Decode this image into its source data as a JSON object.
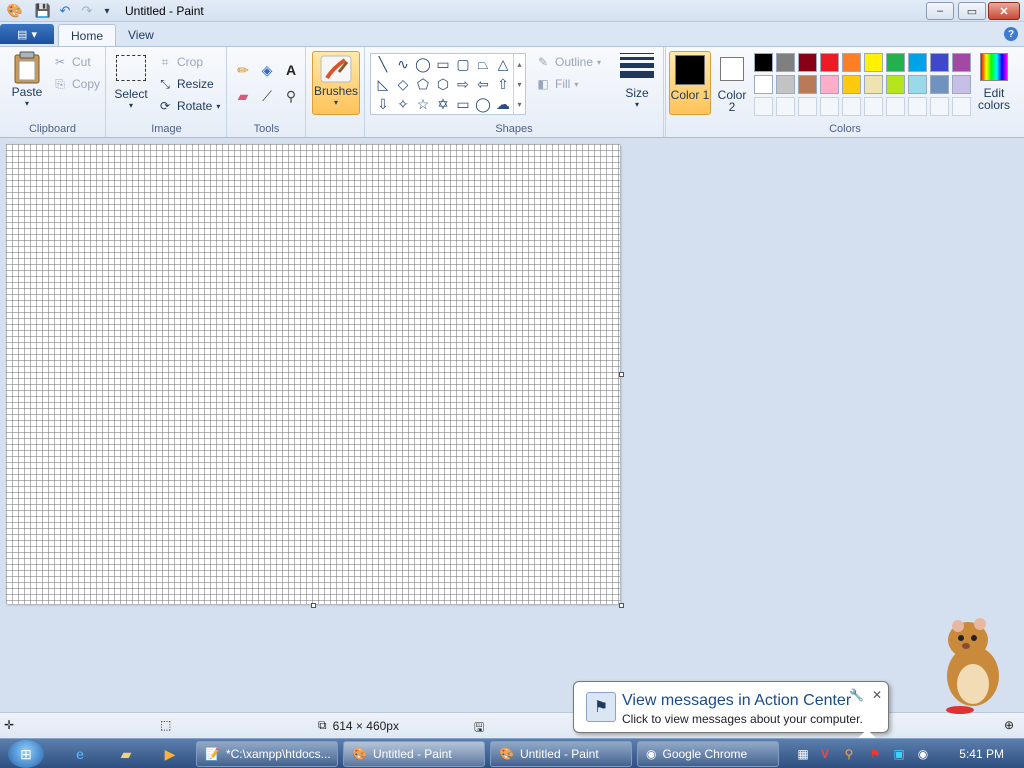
{
  "window": {
    "title": "Untitled - Paint",
    "controls": {
      "minimize": "–",
      "maximize": "▭",
      "close": "✕"
    }
  },
  "tabs": {
    "home": "Home",
    "view": "View"
  },
  "ribbon": {
    "clipboard": {
      "label": "Clipboard",
      "paste": "Paste",
      "cut": "Cut",
      "copy": "Copy"
    },
    "image": {
      "label": "Image",
      "select": "Select",
      "crop": "Crop",
      "resize": "Resize",
      "rotate": "Rotate"
    },
    "tools": {
      "label": "Tools"
    },
    "brushes": {
      "label": "Brushes"
    },
    "shapes": {
      "label": "Shapes",
      "outline": "Outline",
      "fill": "Fill"
    },
    "size": {
      "label": "Size"
    },
    "colors": {
      "label": "Colors",
      "color1": "Color 1",
      "color2": "Color 2",
      "edit": "Edit colors",
      "row1": [
        "#000000",
        "#7f7f7f",
        "#880015",
        "#ed1c24",
        "#ff7f27",
        "#fff200",
        "#22b14c",
        "#00a2e8",
        "#3f48cc",
        "#a349a4"
      ],
      "row2": [
        "#ffffff",
        "#c3c3c3",
        "#b97a57",
        "#ffaec9",
        "#ffc90e",
        "#efe4b0",
        "#b5e61d",
        "#99d9ea",
        "#7092be",
        "#c8bfe7"
      ]
    }
  },
  "status": {
    "dimensions": "614 × 460px"
  },
  "notification": {
    "title": "View messages in Action Center",
    "text": "Click to view messages about your computer."
  },
  "taskbar": {
    "tasks": [
      "*C:\\xampp\\htdocs...",
      "Untitled - Paint",
      "Untitled - Paint",
      "Google Chrome"
    ],
    "clock": "5:41 PM"
  }
}
